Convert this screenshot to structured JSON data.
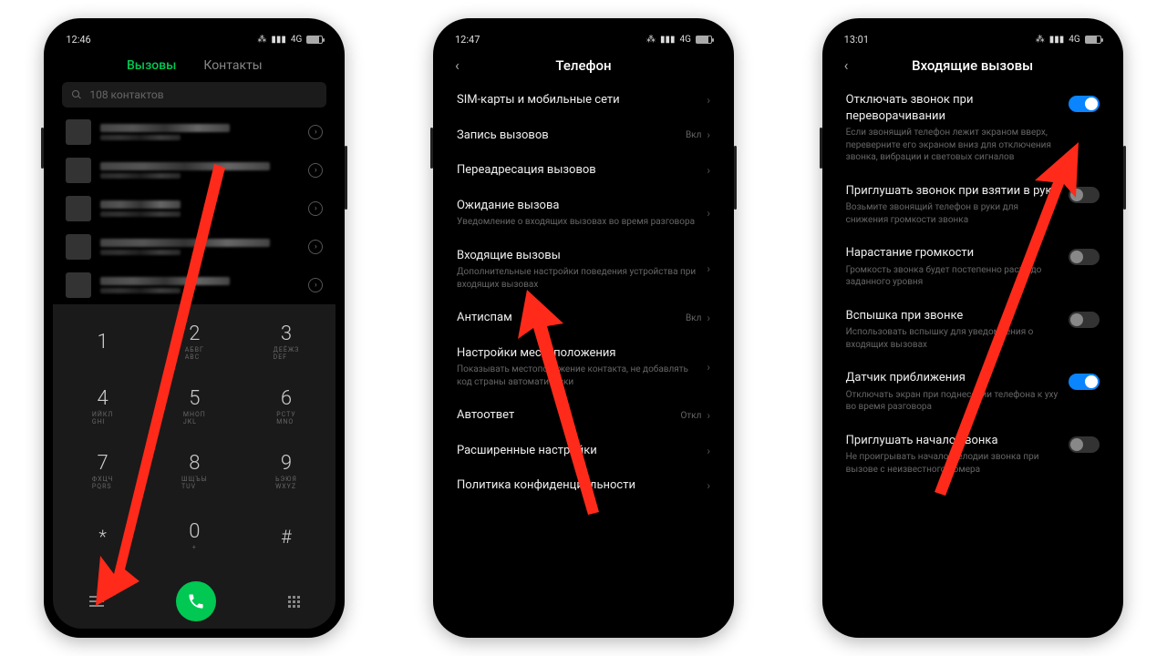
{
  "screen1": {
    "time": "12:46",
    "net": "4G",
    "tab_calls": "Вызовы",
    "tab_contacts": "Контакты",
    "search_placeholder": "108 контактов",
    "keys": [
      {
        "n": "1",
        "l": ""
      },
      {
        "n": "2",
        "l": "АБВГ\nABC"
      },
      {
        "n": "3",
        "l": "ДЕЁЖЗ\nDEF"
      },
      {
        "n": "4",
        "l": "ИЙКЛ\nGHI"
      },
      {
        "n": "5",
        "l": "МНОП\nJKL"
      },
      {
        "n": "6",
        "l": "РСТУ\nMNO"
      },
      {
        "n": "7",
        "l": "ФХЦЧ\nPQRS"
      },
      {
        "n": "8",
        "l": "ШЩЪЫ\nTUV"
      },
      {
        "n": "9",
        "l": "ЬЭЮЯ\nWXYZ"
      },
      {
        "n": "*",
        "l": ""
      },
      {
        "n": "0",
        "l": "+"
      },
      {
        "n": "#",
        "l": ""
      }
    ]
  },
  "screen2": {
    "time": "12:47",
    "net": "4G",
    "title": "Телефон",
    "items": [
      {
        "lbl": "SIM-карты и мобильные сети",
        "sub": "",
        "rt": ""
      },
      {
        "lbl": "Запись вызовов",
        "sub": "",
        "rt": "Вкл"
      },
      {
        "lbl": "Переадресация вызовов",
        "sub": "",
        "rt": ""
      },
      {
        "lbl": "Ожидание вызова",
        "sub": "Уведомление о входящих вызовах во время разговора",
        "rt": ""
      },
      {
        "lbl": "Входящие вызовы",
        "sub": "Дополнительные настройки поведения устройства при входящих вызовах",
        "rt": ""
      },
      {
        "lbl": "Антиспам",
        "sub": "",
        "rt": "Вкл"
      },
      {
        "lbl": "Настройки местоположения",
        "sub": "Показывать местоположение контакта, не добавлять код страны автоматически",
        "rt": ""
      },
      {
        "lbl": "Автоответ",
        "sub": "",
        "rt": "Откл"
      },
      {
        "lbl": "Расширенные настройки",
        "sub": "",
        "rt": ""
      },
      {
        "lbl": "Политика конфиденциальности",
        "sub": "",
        "rt": ""
      }
    ]
  },
  "screen3": {
    "time": "13:01",
    "net": "4G",
    "title": "Входящие вызовы",
    "items": [
      {
        "lbl": "Отключать звонок при переворачивании",
        "sub": "Если звонящий телефон лежит экраном вверх, переверните его экраном вниз для отключения звонка, вибрации и световых сигналов",
        "on": true
      },
      {
        "lbl": "Приглушать звонок при взятии в руки",
        "sub": "Возьмите звонящий телефон в руки для снижения громкости звонка",
        "on": false
      },
      {
        "lbl": "Нарастание громкости",
        "sub": "Громкость звонка будет постепенно расти до заданного уровня",
        "on": false
      },
      {
        "lbl": "Вспышка при звонке",
        "sub": "Использовать вспышку для уведомления о входящих вызовах",
        "on": false
      },
      {
        "lbl": "Датчик приближения",
        "sub": "Отключать экран при поднесении телефона к уху во время разговора",
        "on": true
      },
      {
        "lbl": "Приглушать начало звонка",
        "sub": "Не проигрывать начало мелодии звонка при вызове с неизвестного номера",
        "on": false
      }
    ]
  },
  "status_icons": {
    "bt": "✱",
    "sig": "▮"
  }
}
